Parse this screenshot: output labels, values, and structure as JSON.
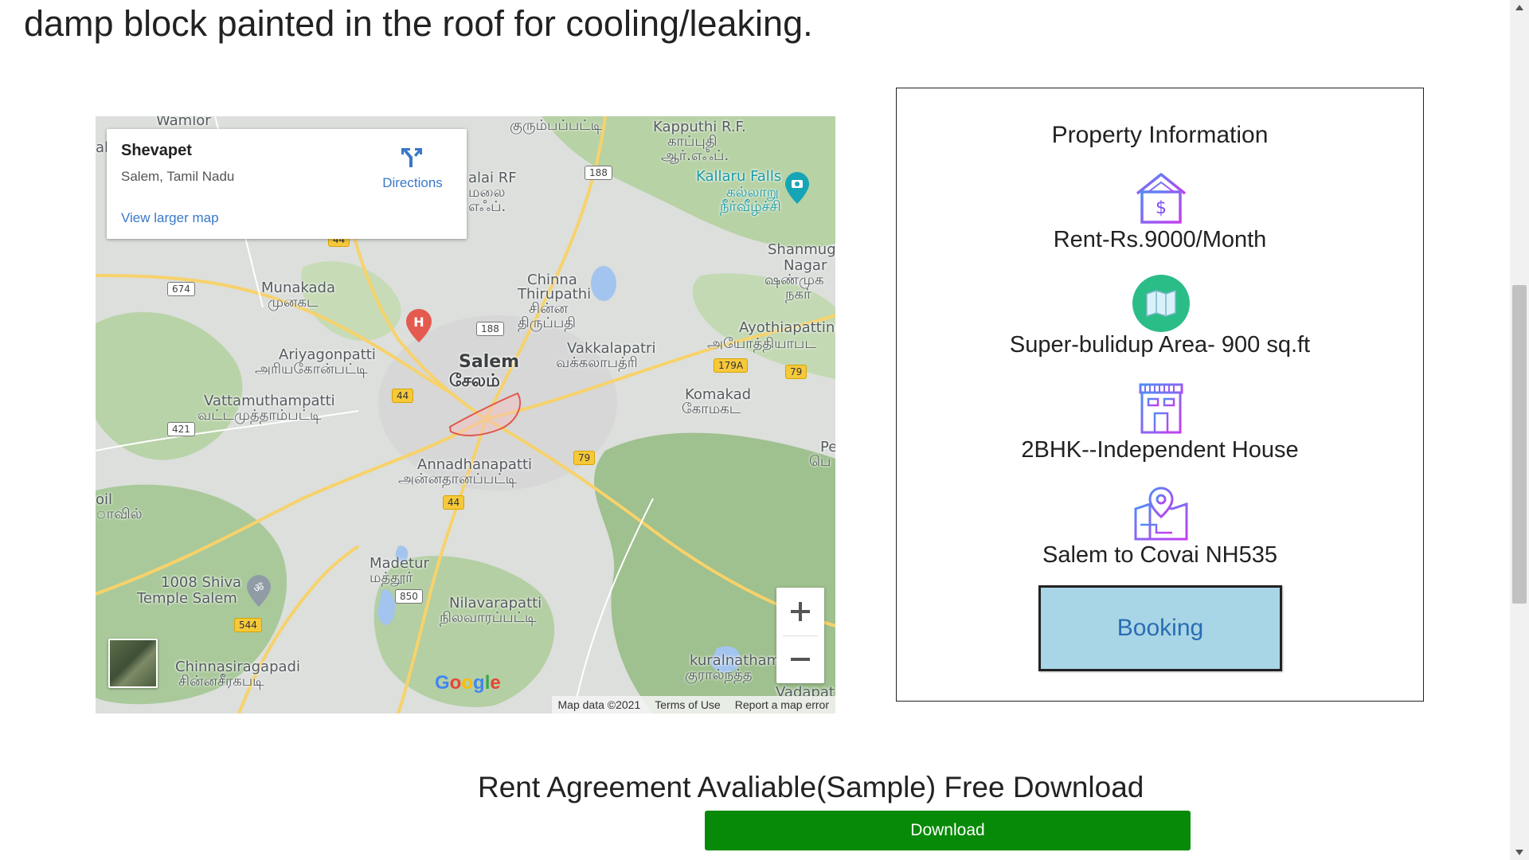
{
  "intro": {
    "text": "damp block painted in the roof for cooling/leaking."
  },
  "map": {
    "info_card": {
      "title": "Shevapet",
      "address": "Salem, Tamil Nadu",
      "view_larger": "View larger map",
      "directions": "Directions"
    },
    "labels": {
      "wamlor": "Wamlor",
      "kurumbapatti": "குரும்பப்பட்டி",
      "kapputhi_en": "Kapputhi R.F.",
      "kapputhi_ta": "காப்புதி",
      "kapputhi_ta2": "ஆர்.எஃப்.",
      "kallaru_en": "Kallaru Falls",
      "kallaru_ta": "கல்லாறு",
      "kallaru_ta2": "நீர்வீழ்ச்சி",
      "alai_rf": "alai RF",
      "alai_ta": "மலை",
      "alai_ta2": "எஃப்.",
      "al": "al",
      "shanmuga_en": "Shanmuga",
      "shanmuga_en2": "Nagar",
      "shanmuga_ta": "ஷண்முக",
      "shanmuga_ta2": "நகர்",
      "munakada_en": "Munakada",
      "munakada_ta": "முனகட",
      "chinna_en": "Chinna",
      "chinna_en2": "Thirupathi",
      "chinna_ta": "சின்ன",
      "chinna_ta2": "திருப்பதி",
      "ayothia_en": "Ayothiapattina",
      "ayothia_ta": "அயோத்தியாபட",
      "ariyagon_en": "Ariyagonpatti",
      "ariyagon_ta": "அரியகோன்பட்டி",
      "vakkal_en": "Vakkalapatri",
      "vakkal_ta": "வக்கலாபத்ரி",
      "salem_en": "Salem",
      "salem_ta": "சேலம்",
      "vattamu_en": "Vattamuthampatti",
      "vattamu_ta": "வட்டமுத்தாம்பட்டி",
      "komakad_en": "Komakad",
      "komakad_ta": "கோமகட",
      "annadhana_en": "Annadhanapatti",
      "annadhana_ta": "அன்னதானப்பட்டி",
      "pe": "Pe",
      "pe_ta": "பெ",
      "oil": "oil",
      "oil_ta": "ாவில்",
      "madetur_en": "Madetur",
      "madetur_ta": "மத்தூர்",
      "shiva_en": "1008 Shiva",
      "shiva_en2": "Temple Salem",
      "nilavar_en": "Nilavarapatti",
      "nilavar_ta": "நிலவாரப்பட்டி",
      "chinnasir_en": "Chinnasiragapadi",
      "chinnasir_ta": "சின்னசீரகபடி",
      "kuraln_en": "kuralnatham",
      "kuraln_ta": "குரால்நத்த",
      "vadapat": "Vadapat"
    },
    "shields": {
      "s188a": "188",
      "s188b": "188",
      "s674": "674",
      "s44a": "44",
      "s44b": "44",
      "s44c": "44",
      "s179a": "179A",
      "s79a": "79",
      "s79b": "79",
      "s421": "421",
      "s850": "850",
      "s544": "544"
    },
    "google": "Google",
    "footer": {
      "map_data": "Map data ©2021",
      "terms": "Terms of Use",
      "report": "Report a map error"
    },
    "zoom_in": "+",
    "zoom_out": "−"
  },
  "property": {
    "title": "Property Information",
    "items": [
      {
        "icon": "house-rent-icon",
        "text": "Rent-Rs.9000/Month"
      },
      {
        "icon": "map-area-icon",
        "text": "Super-bulidup Area- 900 sq.ft"
      },
      {
        "icon": "building-icon",
        "text": "2BHK--Independent House"
      },
      {
        "icon": "location-pin-icon",
        "text": "Salem to Covai NH535"
      }
    ],
    "booking_label": "Booking"
  },
  "download": {
    "heading": "Rent Agreement Avaliable(Sample) Free Download",
    "button_label": "Download"
  },
  "colors": {
    "download_green": "#078a07",
    "booking_bg": "#a9d6e6",
    "booking_text": "#2a6db4",
    "icon_purple": "#8a3ff0",
    "map_link_blue": "#3a78c9"
  }
}
